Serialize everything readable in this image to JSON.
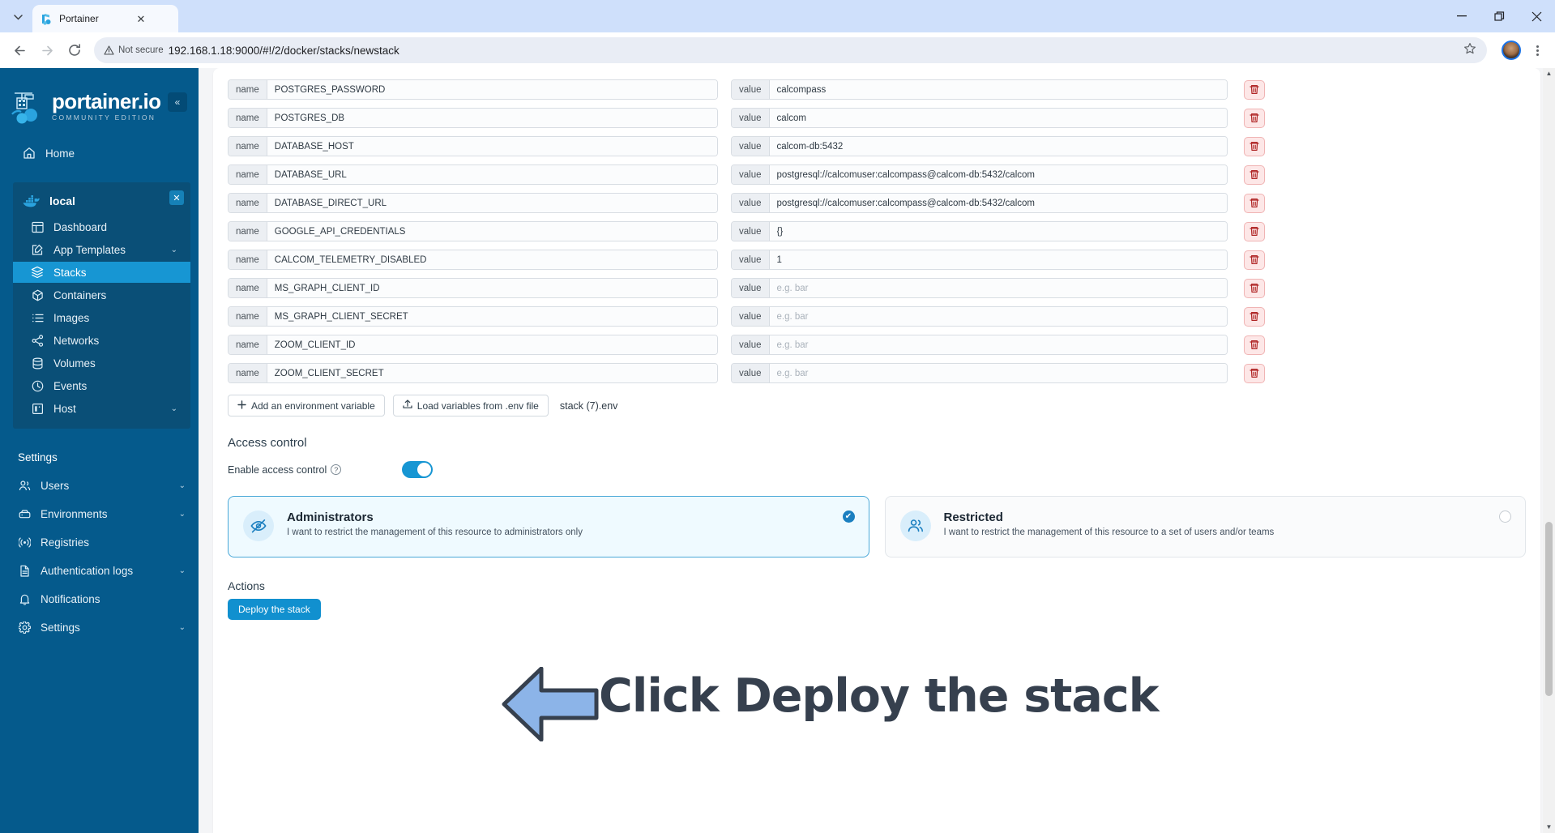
{
  "browser": {
    "tab_title": "Portainer",
    "tab_chevron_icon": "chevron-down-icon",
    "tab_close_icon": "close-icon",
    "back_icon": "arrow-left-icon",
    "forward_icon": "arrow-right-icon",
    "reload_icon": "reload-icon",
    "security_label": "Not secure",
    "url": "192.168.1.18:9000/#!/2/docker/stacks/newstack",
    "bookmark_icon": "star-icon",
    "profile_icon": "avatar",
    "menu_icon": "kebab-menu-icon",
    "minimize_label": "–",
    "restore_label": "❐",
    "close_label": "✕"
  },
  "sidebar": {
    "brand_name": "portainer.io",
    "brand_sub": "COMMUNITY EDITION",
    "collapse_icon": "«",
    "home": {
      "label": "Home",
      "icon": "home-icon"
    },
    "environment": {
      "name": "local",
      "icon": "docker-icon",
      "close_icon": "✕",
      "items": [
        {
          "label": "Dashboard",
          "icon": "dashboard-icon",
          "active": false,
          "chevron": ""
        },
        {
          "label": "App Templates",
          "icon": "templates-icon",
          "active": false,
          "chevron": "⌄"
        },
        {
          "label": "Stacks",
          "icon": "stacks-icon",
          "active": true,
          "chevron": ""
        },
        {
          "label": "Containers",
          "icon": "containers-icon",
          "active": false,
          "chevron": ""
        },
        {
          "label": "Images",
          "icon": "images-icon",
          "active": false,
          "chevron": ""
        },
        {
          "label": "Networks",
          "icon": "networks-icon",
          "active": false,
          "chevron": ""
        },
        {
          "label": "Volumes",
          "icon": "volumes-icon",
          "active": false,
          "chevron": ""
        },
        {
          "label": "Events",
          "icon": "events-icon",
          "active": false,
          "chevron": ""
        },
        {
          "label": "Host",
          "icon": "host-icon",
          "active": false,
          "chevron": "⌄"
        }
      ]
    },
    "settings_label": "Settings",
    "settings_items": [
      {
        "label": "Users",
        "icon": "users-icon",
        "chevron": "⌄"
      },
      {
        "label": "Environments",
        "icon": "environments-icon",
        "chevron": "⌄"
      },
      {
        "label": "Registries",
        "icon": "registries-icon",
        "chevron": ""
      },
      {
        "label": "Authentication logs",
        "icon": "auth-logs-icon",
        "chevron": "⌄"
      },
      {
        "label": "Notifications",
        "icon": "bell-icon",
        "chevron": ""
      },
      {
        "label": "Settings",
        "icon": "gear-icon",
        "chevron": "⌄"
      }
    ]
  },
  "main": {
    "env_label_name": "name",
    "env_label_value": "value",
    "value_placeholder": "e.g. bar",
    "delete_icon": "trash-icon",
    "env_vars": [
      {
        "name": "POSTGRES_PASSWORD",
        "value": "calcompass"
      },
      {
        "name": "POSTGRES_DB",
        "value": "calcom"
      },
      {
        "name": "DATABASE_HOST",
        "value": "calcom-db:5432"
      },
      {
        "name": "DATABASE_URL",
        "value": "postgresql://calcomuser:calcompass@calcom-db:5432/calcom"
      },
      {
        "name": "DATABASE_DIRECT_URL",
        "value": "postgresql://calcomuser:calcompass@calcom-db:5432/calcom"
      },
      {
        "name": "GOOGLE_API_CREDENTIALS",
        "value": "{}"
      },
      {
        "name": "CALCOM_TELEMETRY_DISABLED",
        "value": "1"
      },
      {
        "name": "MS_GRAPH_CLIENT_ID",
        "value": ""
      },
      {
        "name": "MS_GRAPH_CLIENT_SECRET",
        "value": ""
      },
      {
        "name": "ZOOM_CLIENT_ID",
        "value": ""
      },
      {
        "name": "ZOOM_CLIENT_SECRET",
        "value": ""
      }
    ],
    "add_variable_button": "Add an environment variable",
    "add_variable_icon": "plus-icon",
    "load_env_button": "Load variables from .env file",
    "load_env_icon": "upload-icon",
    "env_filename": "stack (7).env",
    "access_control_title": "Access control",
    "enable_access_control_label": "Enable access control",
    "help_icon": "question-icon",
    "access_control_enabled": true,
    "access_options": [
      {
        "title": "Administrators",
        "description": "I want to restrict the management of this resource to administrators only",
        "icon": "eye-off-icon",
        "selected": true,
        "check_icon": "✔"
      },
      {
        "title": "Restricted",
        "description": "I want to restrict the management of this resource to a set of users and/or teams",
        "icon": "users-group-icon",
        "selected": false,
        "check_icon": ""
      }
    ],
    "actions_title": "Actions",
    "deploy_button": "Deploy the stack"
  },
  "annotation": {
    "text": "Click Deploy the stack",
    "arrow_icon": "left-arrow-annotation",
    "arrow_fill": "#8cb4e8",
    "arrow_stroke": "#36404e",
    "text_color": "#36404e"
  },
  "scrollbar": {
    "up_arrow": "▲",
    "down_arrow": "▼"
  },
  "colors": {
    "sidebar_bg": "#055a8c",
    "sidebar_active": "#1796d3",
    "accent": "#1190cf",
    "danger": "#b02626"
  }
}
